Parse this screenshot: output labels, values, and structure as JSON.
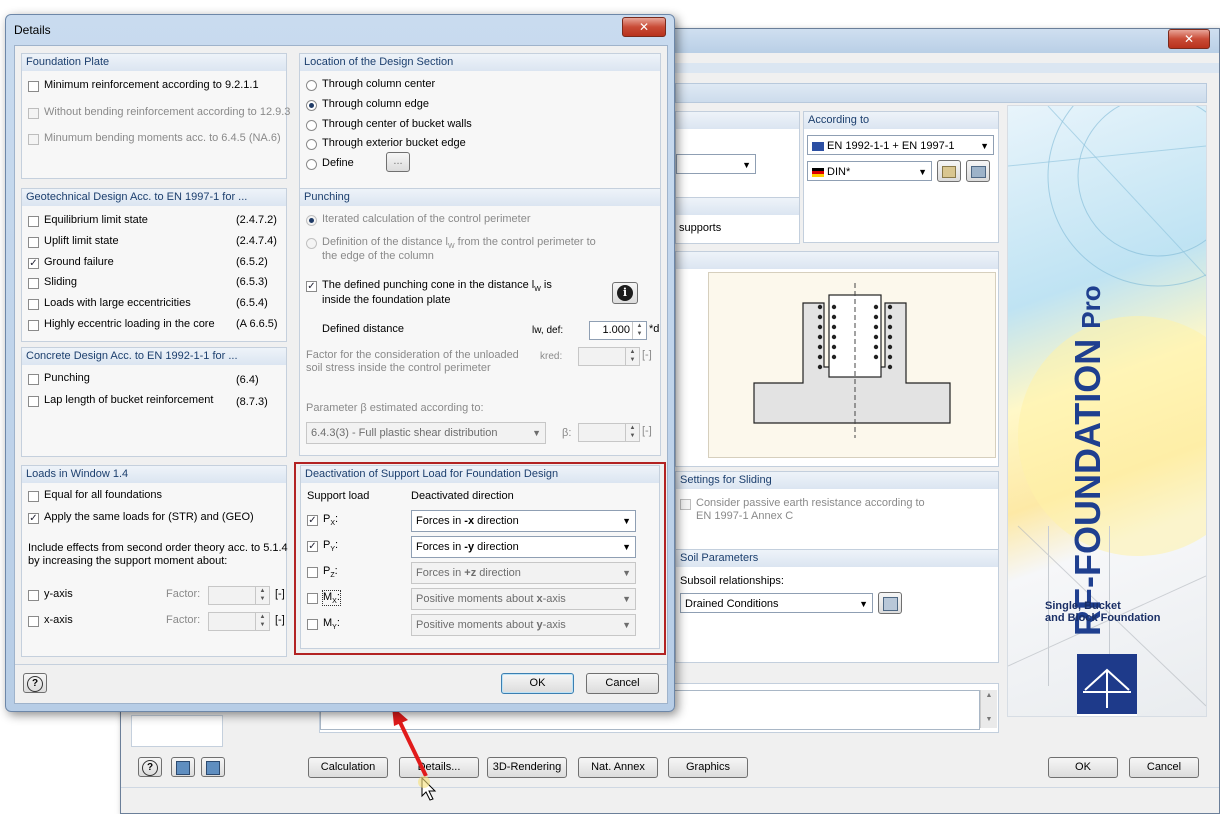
{
  "main_window": {
    "close_glyph": "✕",
    "according_to": {
      "header": "According to",
      "standard": "EN 1992-1-1 + EN 1997-1",
      "annex": "DIN*"
    },
    "supports_text": "supports",
    "sliding": {
      "header": "Settings for Sliding",
      "passive_label": "Consider passive earth resistance according to",
      "passive_label2": "EN 1997-1 Annex C"
    },
    "soil": {
      "header": "Soil Parameters",
      "subsoil_label": "Subsoil relationships:",
      "subsoil_value": "Drained Conditions"
    },
    "brand": {
      "title": "RF-FOUNDATION",
      "suffix": "Pro",
      "subtitle1": "Single, Bucket",
      "subtitle2": "and Block Foundation"
    },
    "buttons": {
      "calculation": "Calculation",
      "details": "Details...",
      "rendering": "3D-Rendering",
      "nat_annex": "Nat. Annex",
      "graphics": "Graphics",
      "ok": "OK",
      "cancel": "Cancel"
    }
  },
  "dialog": {
    "title": "Details",
    "close_glyph": "✕",
    "foundation_plate": {
      "header": "Foundation Plate",
      "items": [
        {
          "label": "Minimum reinforcement according to 9.2.1.1",
          "checked": false,
          "disabled": false
        },
        {
          "label": "Without bending reinforcement according to 12.9.3",
          "checked": false,
          "disabled": true
        },
        {
          "label": "Minumum bending moments acc. to 6.4.5 (NA.6)",
          "checked": false,
          "disabled": true
        }
      ]
    },
    "geotechnical": {
      "header": "Geotechnical Design Acc. to EN 1997-1 for ...",
      "items": [
        {
          "label": "Equilibrium limit state",
          "ref": "(2.4.7.2)",
          "checked": false
        },
        {
          "label": "Uplift limit state",
          "ref": "(2.4.7.4)",
          "checked": false
        },
        {
          "label": "Ground failure",
          "ref": "(6.5.2)",
          "checked": true
        },
        {
          "label": "Sliding",
          "ref": "(6.5.3)",
          "checked": false
        },
        {
          "label": "Loads with large eccentricities",
          "ref": "(6.5.4)",
          "checked": false
        },
        {
          "label": "Highly eccentric loading in the core",
          "ref": "(A 6.6.5)",
          "checked": false
        }
      ]
    },
    "concrete": {
      "header": "Concrete Design Acc. to EN 1992-1-1 for ...",
      "items": [
        {
          "label": "Punching",
          "ref": "(6.4)",
          "checked": false
        },
        {
          "label": "Lap length of bucket reinforcement",
          "ref": "(8.7.3)",
          "checked": false
        }
      ]
    },
    "loads": {
      "header": "Loads in Window 1.4",
      "equal": "Equal for all foundations",
      "same_loads": "Apply the same loads for (STR) and (GEO)",
      "include1": "Include effects from second order theory acc. to 5.1.4",
      "include2": "by increasing the support moment about:",
      "y_axis": "y-axis",
      "x_axis": "x-axis",
      "factor": "Factor:",
      "unit": "[-]"
    },
    "location": {
      "header": "Location of the Design Section",
      "options": [
        {
          "label": "Through column center",
          "selected": false
        },
        {
          "label": "Through column edge",
          "selected": true
        },
        {
          "label": "Through center of bucket walls",
          "selected": false
        },
        {
          "label": "Through exterior bucket edge",
          "selected": false
        },
        {
          "label": "Define",
          "selected": false
        }
      ],
      "dots": "..."
    },
    "punching": {
      "header": "Punching",
      "iterated": "Iterated calculation of the control perimeter",
      "definition1": "Definition of the distance l",
      "definition_sub": "W",
      "definition1b": " from the control perimeter to",
      "definition2": "the edge of the column",
      "cone1": "The defined punching cone in the distance l",
      "cone_sub": "W",
      "cone1b": " is",
      "cone2": "inside the foundation plate",
      "info_glyph": "i",
      "defined_distance": "Defined distance",
      "lw_def": "lw, def:",
      "lw_value": "1.000",
      "lw_unit": "*d",
      "factor1": "Factor for the consideration of the unloaded",
      "factor2": "soil stress inside the control perimeter",
      "kred": "kred:",
      "kred_unit": "[-]",
      "beta_label": "Parameter β estimated according to:",
      "beta_value": "6.4.3(3) - Full plastic shear distribution",
      "beta_sym": "β:",
      "beta_unit": "[-]"
    },
    "deactivation": {
      "header": "Deactivation of Support Load for Foundation Design",
      "col_support": "Support load",
      "col_direction": "Deactivated direction",
      "rows": [
        {
          "label": "P",
          "sub": "X",
          "checked": true,
          "pre": "Forces in ",
          "bold": "-x",
          "post": " direction",
          "enabled": true
        },
        {
          "label": "P",
          "sub": "Y",
          "checked": true,
          "pre": "Forces in ",
          "bold": "-y",
          "post": " direction",
          "enabled": true
        },
        {
          "label": "P",
          "sub": "Z",
          "checked": false,
          "pre": "Forces in ",
          "bold": "+z",
          "post": " direction",
          "enabled": false
        },
        {
          "label": "M",
          "sub": "X",
          "checked": false,
          "pre": "Positive moments about ",
          "bold": "x",
          "post": "-axis",
          "enabled": false
        },
        {
          "label": "M",
          "sub": "Y",
          "checked": false,
          "pre": "Positive moments about ",
          "bold": "y",
          "post": "-axis",
          "enabled": false
        }
      ]
    },
    "ok": "OK",
    "cancel": "Cancel"
  },
  "colors": {
    "highlight_border": "#b22222",
    "arrow": "#e11b1b",
    "brand_blue": "#1f3f8f"
  }
}
